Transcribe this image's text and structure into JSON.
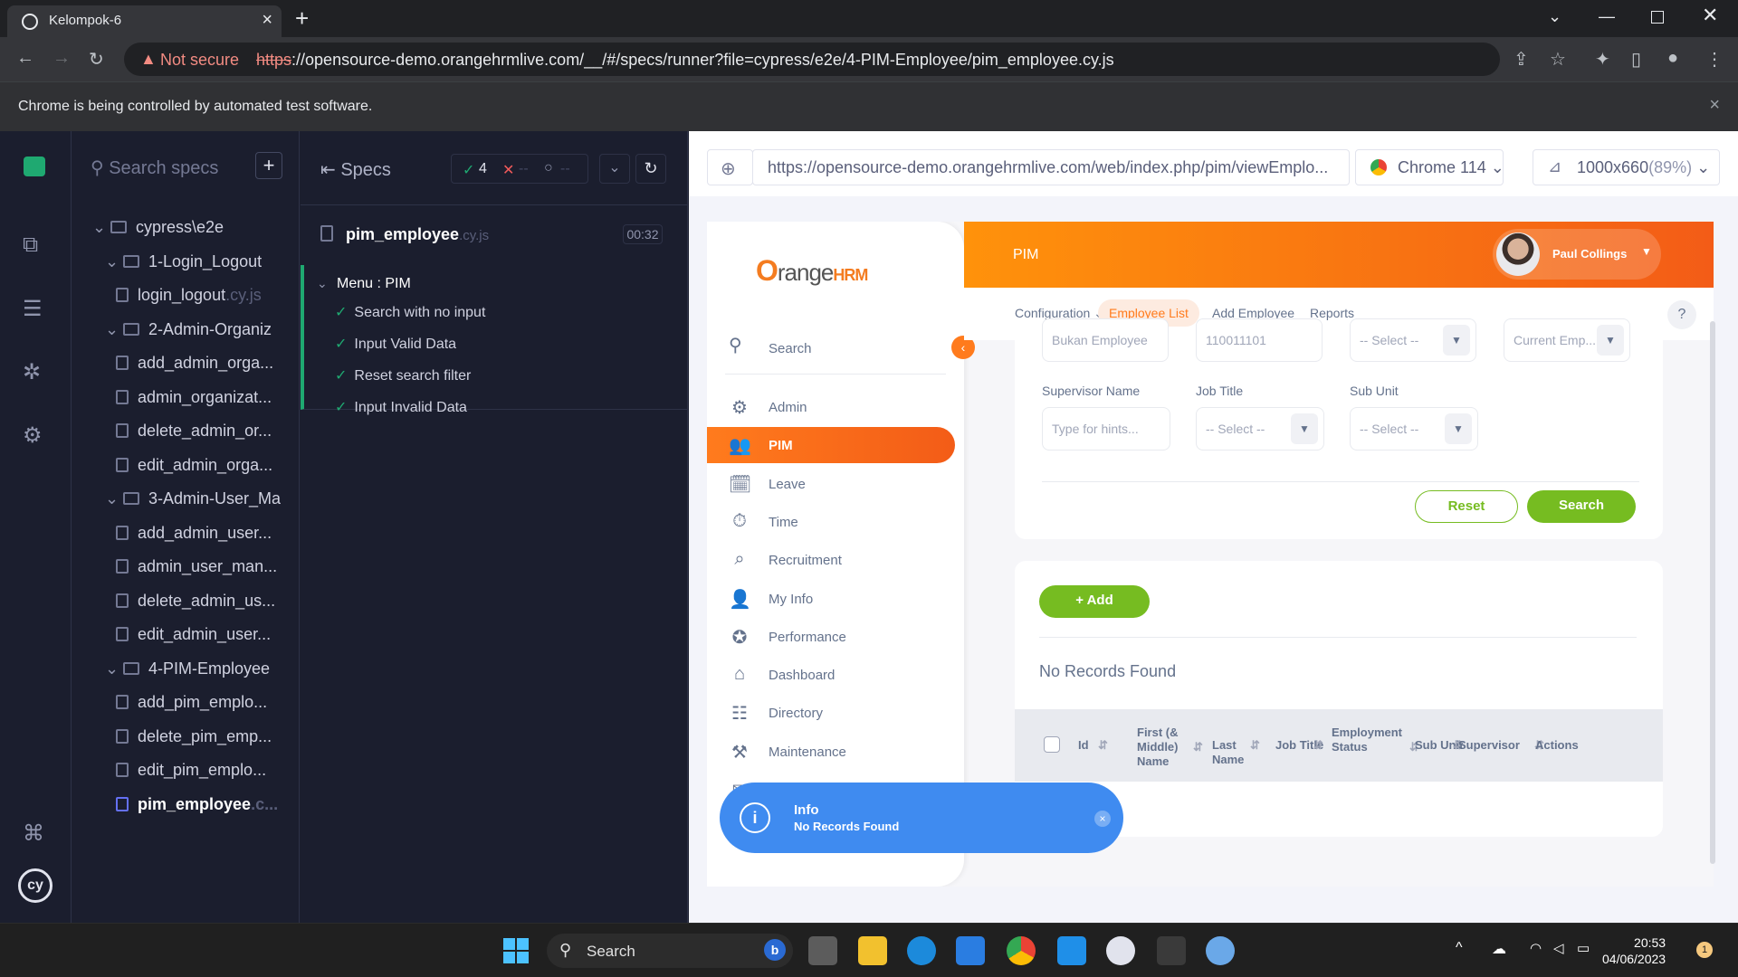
{
  "browser": {
    "tab_title": "Kelompok-6",
    "security_label": "Not secure",
    "url_scheme": "https",
    "url_rest": "://opensource-demo.orangehrmlive.com/__/#/specs/runner?file=cypress/e2e/4-PIM-Employee/pim_employee.cy.js",
    "infobar_message": "Chrome is being controlled by automated test software."
  },
  "cypress": {
    "search_placeholder": "Search specs",
    "tree": [
      {
        "type": "folder",
        "label": "cypress\\e2e",
        "level": 0
      },
      {
        "type": "folder",
        "label": "1-Login_Logout",
        "level": 1
      },
      {
        "type": "file",
        "label": "login_logout",
        "ext": ".cy.js",
        "level": 2
      },
      {
        "type": "folder",
        "label": "2-Admin-Organiz",
        "level": 1
      },
      {
        "type": "file",
        "label": "add_admin_orga...",
        "ext": "",
        "level": 2
      },
      {
        "type": "file",
        "label": "admin_organizat...",
        "ext": "",
        "level": 2
      },
      {
        "type": "file",
        "label": "delete_admin_or...",
        "ext": "",
        "level": 2
      },
      {
        "type": "file",
        "label": "edit_admin_orga...",
        "ext": "",
        "level": 2
      },
      {
        "type": "folder",
        "label": "3-Admin-User_Ma",
        "level": 1
      },
      {
        "type": "file",
        "label": "add_admin_user...",
        "ext": "",
        "level": 2
      },
      {
        "type": "file",
        "label": "admin_user_man...",
        "ext": "",
        "level": 2
      },
      {
        "type": "file",
        "label": "delete_admin_us...",
        "ext": "",
        "level": 2
      },
      {
        "type": "file",
        "label": "edit_admin_user...",
        "ext": "",
        "level": 2
      },
      {
        "type": "folder",
        "label": "4-PIM-Employee",
        "level": 1
      },
      {
        "type": "file",
        "label": "add_pim_emplo...",
        "ext": "",
        "level": 2
      },
      {
        "type": "file",
        "label": "delete_pim_emp...",
        "ext": "",
        "level": 2
      },
      {
        "type": "file",
        "label": "edit_pim_emplo...",
        "ext": "",
        "level": 2
      },
      {
        "type": "file",
        "label": "pim_employee",
        "ext": ".c...",
        "level": 2,
        "active": true
      }
    ],
    "reporter": {
      "specs_label": "Specs",
      "passed_count": "4",
      "failed_count": "--",
      "pending_count": "--",
      "spec_file": "pim_employee",
      "spec_ext": ".cy.js",
      "duration": "00:32",
      "suite": "Menu : PIM",
      "tests": [
        "Search with no input",
        "Input Valid Data",
        "Reset search filter",
        "Input Invalid Data"
      ]
    },
    "aut": {
      "url": "https://opensource-demo.orangehrmlive.com/web/index.php/pim/viewEmplo...",
      "browser_label": "Chrome 114",
      "viewport_label": "1000x660",
      "zoom_label": "(89%)"
    }
  },
  "orangehrm": {
    "logo_text": "range",
    "logo_hrm": "HRM",
    "search_label": "Search",
    "menu": [
      {
        "label": "Admin",
        "icon": "admin-icon"
      },
      {
        "label": "PIM",
        "icon": "pim-icon",
        "active": true
      },
      {
        "label": "Leave",
        "icon": "leave-icon"
      },
      {
        "label": "Time",
        "icon": "time-icon"
      },
      {
        "label": "Recruitment",
        "icon": "recruitment-icon"
      },
      {
        "label": "My Info",
        "icon": "my-info-icon"
      },
      {
        "label": "Performance",
        "icon": "performance-icon"
      },
      {
        "label": "Dashboard",
        "icon": "dashboard-icon"
      },
      {
        "label": "Directory",
        "icon": "directory-icon"
      },
      {
        "label": "Maintenance",
        "icon": "maintenance-icon"
      },
      {
        "label": "Buzz",
        "icon": "buzz-icon"
      }
    ],
    "page_title": "PIM",
    "user_name": "Paul Collings",
    "tabs": [
      "Configuration",
      "Employee List",
      "Add Employee",
      "Reports"
    ],
    "help": "?",
    "filter": {
      "employee_name_value": "Bukan Employee",
      "employee_id_value": "110011101",
      "employment_status_value": "-- Select --",
      "include_value": "Current Emp...",
      "supervisor_label": "Supervisor Name",
      "supervisor_placeholder": "Type for hints...",
      "job_title_label": "Job Title",
      "job_title_value": "-- Select --",
      "sub_unit_label": "Sub Unit",
      "sub_unit_value": "-- Select --",
      "reset_label": "Reset",
      "search_label": "Search"
    },
    "add_label": "Add",
    "no_records": "No Records Found",
    "table_headers": [
      "Id",
      "First (& Middle) Name",
      "Last Name",
      "Job Title",
      "Employment Status",
      "Sub Unit",
      "Supervisor",
      "Actions"
    ],
    "toast": {
      "title": "Info",
      "message": "No Records Found"
    }
  },
  "taskbar": {
    "search_label": "Search",
    "time": "20:53",
    "date": "04/06/2023",
    "notification_count": "1"
  },
  "colors": {
    "accent_orange": "#ff7b1d",
    "accent_green": "#76bc21",
    "toast_blue": "#3f8bf0",
    "cypress_green": "#1fa971"
  }
}
